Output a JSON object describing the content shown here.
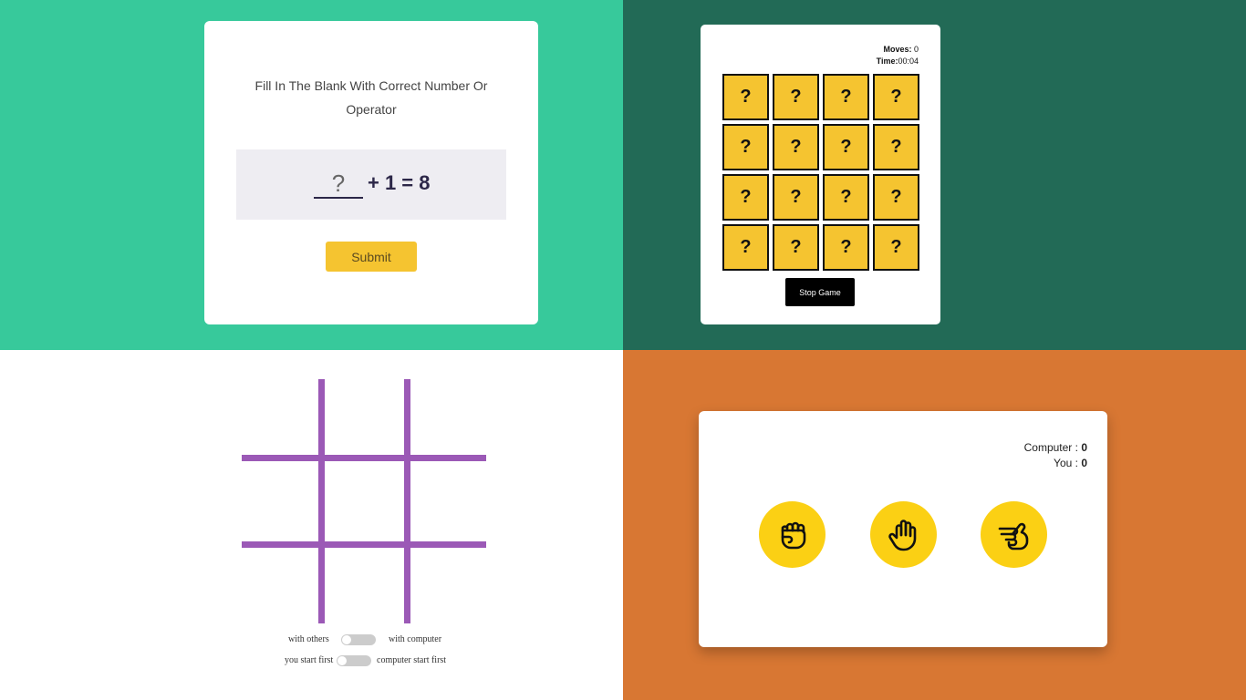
{
  "math_game": {
    "title": "Fill In The Blank With Correct Number Or Operator",
    "blank": "?",
    "expression": "+ 1 = 8",
    "submit_label": "Submit"
  },
  "memory_game": {
    "moves_label": "Moves:",
    "moves_value": "0",
    "time_label": "Time:",
    "time_value": "00:04",
    "tiles": [
      "?",
      "?",
      "?",
      "?",
      "?",
      "?",
      "?",
      "?",
      "?",
      "?",
      "?",
      "?",
      "?",
      "?",
      "?",
      "?"
    ],
    "stop_label": "Stop Game"
  },
  "tic_tac_toe": {
    "mode_left": "with others",
    "mode_right": "with computer",
    "start_left": "you start first",
    "start_right": "computer start first",
    "grid_color": "#9b59b6"
  },
  "rps_game": {
    "computer_label": "Computer :",
    "computer_score": "0",
    "you_label": "You :",
    "you_score": "0",
    "choices": [
      "rock-icon",
      "paper-icon",
      "scissors-icon"
    ]
  },
  "colors": {
    "math_bg": "#37c99b",
    "memory_bg": "#226a56",
    "rps_bg": "#d87733",
    "accent_yellow": "#f5c430"
  }
}
